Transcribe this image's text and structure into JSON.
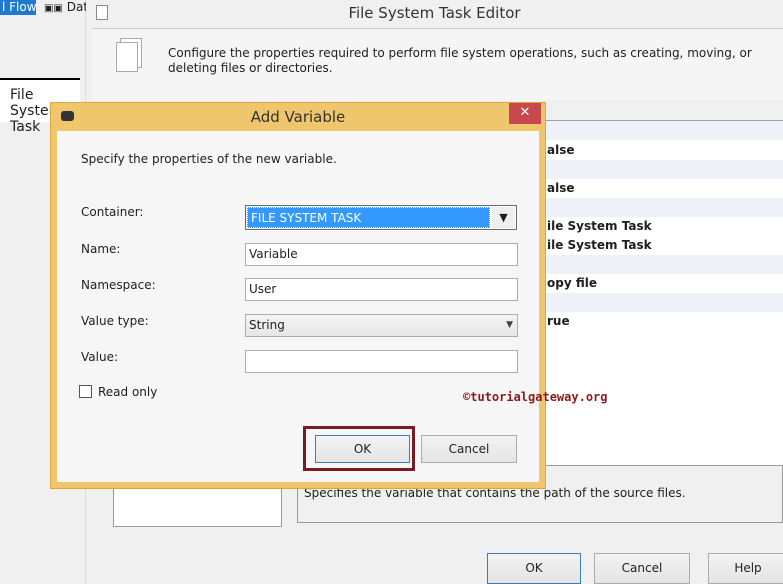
{
  "left_panel": {
    "tab_control_flow": "l Flow",
    "tab_data": "Dat",
    "task_tab": "File System Task"
  },
  "editor": {
    "title": "File System Task Editor",
    "description": "Configure the properties required to perform file system operations, such as creating, moving, or deleting files or directories.",
    "grid_values": [
      "alse",
      "alse",
      "ile System Task",
      "ile System Task",
      "opy file",
      "rue"
    ],
    "property_description": "Specifies the variable that contains the path of the source files.",
    "ok_label": "OK",
    "cancel_label": "Cancel",
    "help_label": "Help"
  },
  "dialog": {
    "title": "Add Variable",
    "close": "✕",
    "instructions": "Specify the properties of the new variable.",
    "container_label": "Container:",
    "container_value": "FILE SYSTEM TASK",
    "name_label": "Name:",
    "name_value": "Variable",
    "namespace_label": "Namespace:",
    "namespace_value": "User",
    "value_type_label": "Value type:",
    "value_type_value": "String",
    "value_label": "Value:",
    "value_value": "",
    "read_only_label": "Read only",
    "read_only_checked": false,
    "ok_label": "OK",
    "cancel_label": "Cancel"
  },
  "watermark": "©tutorialgateway.org"
}
